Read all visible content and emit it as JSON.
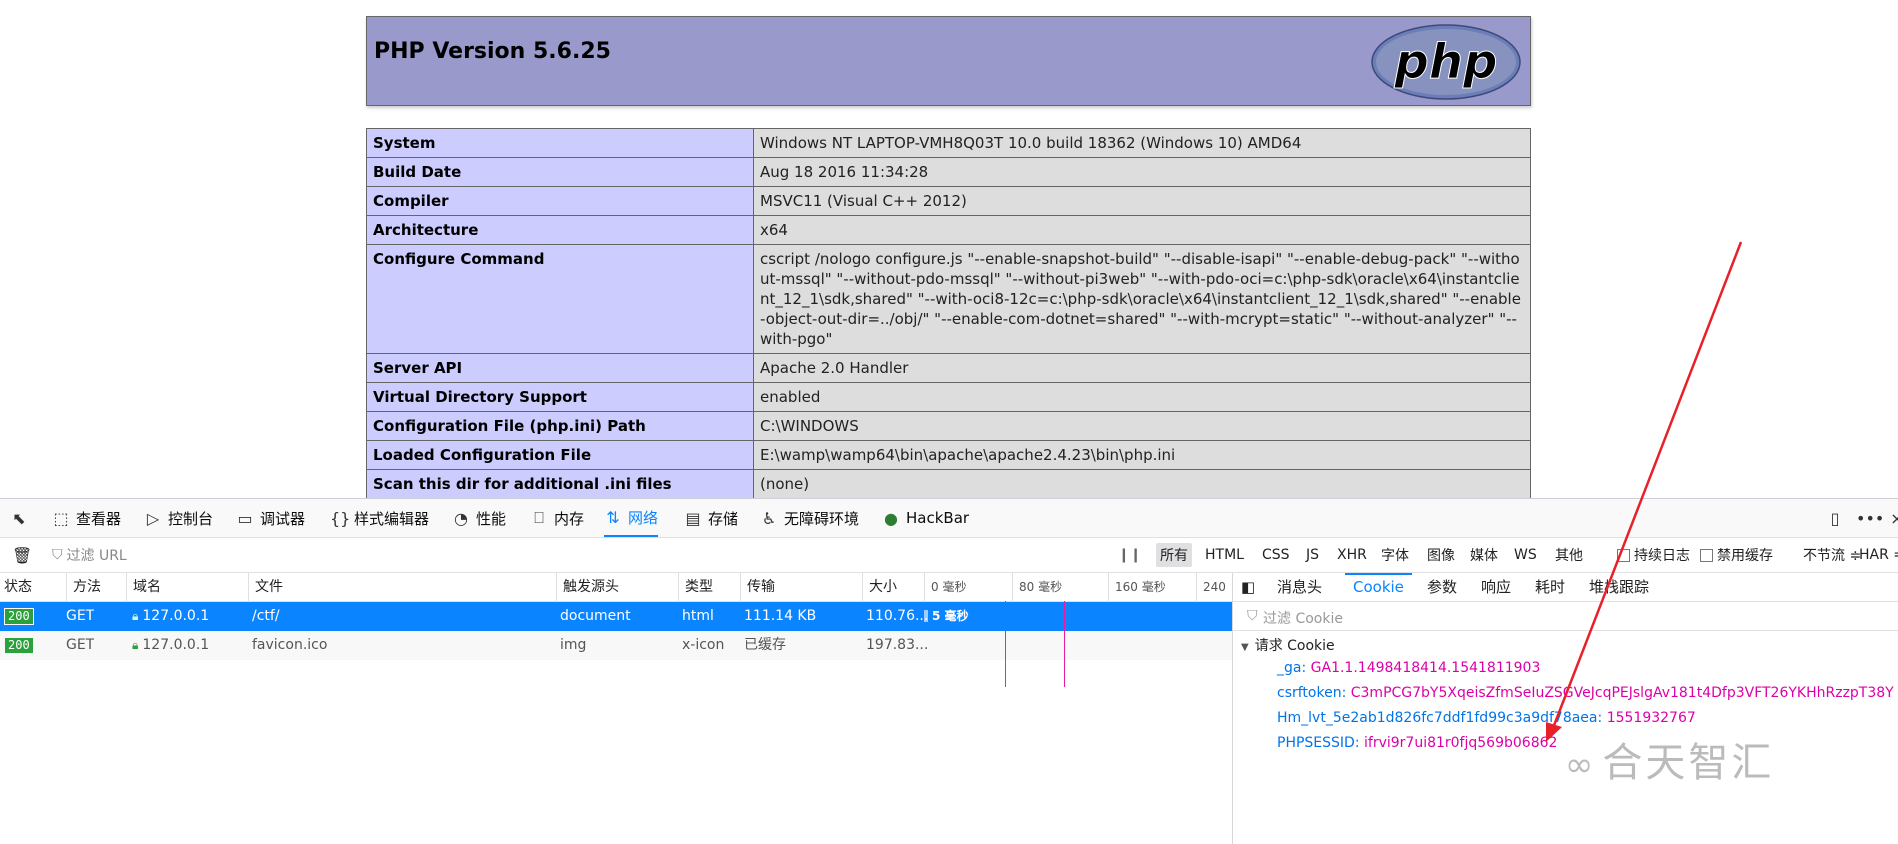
{
  "php": {
    "title": "PHP Version 5.6.25",
    "logo_text": "php",
    "rows": [
      {
        "key": "System",
        "value": "Windows NT LAPTOP-VMH8Q03T 10.0 build 18362 (Windows 10) AMD64"
      },
      {
        "key": "Build Date",
        "value": "Aug 18 2016 11:34:28"
      },
      {
        "key": "Compiler",
        "value": "MSVC11 (Visual C++ 2012)"
      },
      {
        "key": "Architecture",
        "value": "x64"
      },
      {
        "key": "Configure Command",
        "value": "cscript /nologo configure.js \"--enable-snapshot-build\" \"--disable-isapi\" \"--enable-debug-pack\" \"--without-mssql\" \"--without-pdo-mssql\" \"--without-pi3web\" \"--with-pdo-oci=c:\\php-sdk\\oracle\\x64\\instantclient_12_1\\sdk,shared\" \"--with-oci8-12c=c:\\php-sdk\\oracle\\x64\\instantclient_12_1\\sdk,shared\" \"--enable-object-out-dir=../obj/\" \"--enable-com-dotnet=shared\" \"--with-mcrypt=static\" \"--without-analyzer\" \"--with-pgo\""
      },
      {
        "key": "Server API",
        "value": "Apache 2.0 Handler"
      },
      {
        "key": "Virtual Directory Support",
        "value": "enabled"
      },
      {
        "key": "Configuration File (php.ini) Path",
        "value": "C:\\WINDOWS"
      },
      {
        "key": "Loaded Configuration File",
        "value": "E:\\wamp\\wamp64\\bin\\apache\\apache2.4.23\\bin\\php.ini"
      },
      {
        "key": "Scan this dir for additional .ini files",
        "value": "(none)"
      }
    ]
  },
  "devtools": {
    "tabs": [
      {
        "icon": "inspector-icon",
        "glyph": "⬚",
        "label": "查看器"
      },
      {
        "icon": "console-icon",
        "glyph": "▷",
        "label": "控制台"
      },
      {
        "icon": "debugger-icon",
        "glyph": "▭",
        "label": "调试器"
      },
      {
        "icon": "style-editor-icon",
        "glyph": "{}",
        "label": "样式编辑器"
      },
      {
        "icon": "performance-icon",
        "glyph": "◔",
        "label": "性能"
      },
      {
        "icon": "memory-icon",
        "glyph": "⎕",
        "label": "内存"
      },
      {
        "icon": "network-icon",
        "glyph": "⇅",
        "label": "网络",
        "active": true
      },
      {
        "icon": "storage-icon",
        "glyph": "▤",
        "label": "存储"
      },
      {
        "icon": "accessibility-icon",
        "glyph": "♿",
        "label": "无障碍环境"
      },
      {
        "icon": "hackbar-icon",
        "glyph": "●",
        "label": "HackBar"
      }
    ],
    "filter": {
      "url_placeholder": "过滤 URL",
      "types": [
        "所有",
        "HTML",
        "CSS",
        "JS",
        "XHR",
        "字体",
        "图像",
        "媒体",
        "WS",
        "其他"
      ],
      "persist_log": "持续日志",
      "disable_cache": "禁用缓存",
      "throttle": "不节流 ≑",
      "har": "HAR ≑"
    },
    "columns": [
      "状态",
      "方法",
      "域名",
      "文件",
      "触发源头",
      "类型",
      "传输",
      "大小"
    ],
    "timeline_ticks": [
      "0 毫秒",
      "80 毫秒",
      "160 毫秒",
      "240"
    ],
    "requests": [
      {
        "status": "200",
        "method": "GET",
        "domain": "127.0.0.1",
        "file": "/ctf/",
        "cause": "document",
        "type": "html",
        "transferred": "111.14 KB",
        "size": "110.76...",
        "timing": "5 毫秒",
        "selected": true
      },
      {
        "status": "200",
        "method": "GET",
        "domain": "127.0.0.1",
        "file": "favicon.ico",
        "cause": "img",
        "type": "x-icon",
        "transferred": "已缓存",
        "size": "197.83...",
        "selected": false
      }
    ],
    "side_tabs": [
      "消息头",
      "Cookie",
      "参数",
      "响应",
      "耗时",
      "堆栈跟踪"
    ],
    "active_side_tab": "Cookie",
    "cookie_filter_placeholder": "过滤 Cookie",
    "request_cookies_title": "请求 Cookie",
    "cookies": [
      {
        "name": "_ga:",
        "value": "GA1.1.1498418414.1541811903"
      },
      {
        "name": "csrftoken:",
        "value": "C3mPCG7bY5XqeisZfmSeIuZSGVeJcqPEJslgAv181t4Dfp3VFT26YKHhRzzpT38Y"
      },
      {
        "name": "Hm_lvt_5e2ab1d826fc7ddf1fd99c3a9df78aea:",
        "value": "1551932767"
      },
      {
        "name": "PHPSESSID:",
        "value": "ifrvi9r7ui81r0fjq569b06862"
      }
    ]
  },
  "watermark": "合天智汇",
  "colors": {
    "php_header": "#9999cc",
    "php_key": "#ccccff",
    "php_value": "#dddddd",
    "accent": "#0a84ff",
    "status_ok": "#2aa13b",
    "cookie_value": "#dd00a9",
    "arrow": "#e8202a"
  }
}
